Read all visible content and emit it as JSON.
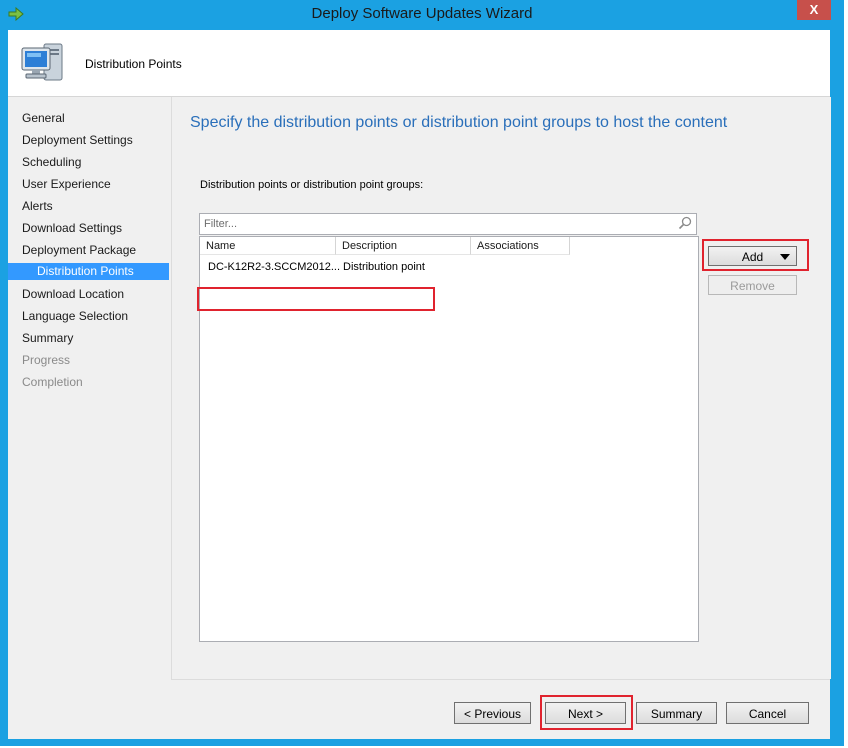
{
  "window": {
    "title": "Deploy Software Updates Wizard",
    "close_label": "X"
  },
  "header": {
    "title": "Distribution Points"
  },
  "nav": {
    "items": [
      {
        "label": "General",
        "state": "normal"
      },
      {
        "label": "Deployment Settings",
        "state": "normal"
      },
      {
        "label": "Scheduling",
        "state": "normal"
      },
      {
        "label": "User Experience",
        "state": "normal"
      },
      {
        "label": "Alerts",
        "state": "normal"
      },
      {
        "label": "Download Settings",
        "state": "normal"
      },
      {
        "label": "Deployment Package",
        "state": "normal"
      },
      {
        "label": "Distribution Points",
        "state": "selected"
      },
      {
        "label": "Download Location",
        "state": "normal"
      },
      {
        "label": "Language Selection",
        "state": "normal"
      },
      {
        "label": "Summary",
        "state": "normal"
      },
      {
        "label": "Progress",
        "state": "disabled"
      },
      {
        "label": "Completion",
        "state": "disabled"
      }
    ]
  },
  "main": {
    "heading": "Specify the distribution points or distribution point groups to host the content",
    "list_label": "Distribution points or distribution point groups:",
    "filter_placeholder": "Filter...",
    "columns": [
      "Name",
      "Description",
      "Associations"
    ],
    "rows": [
      {
        "name": "DC-K12R2-3.SCCM2012...",
        "description": "Distribution point",
        "associations": ""
      }
    ],
    "add_label": "Add",
    "remove_label": "Remove"
  },
  "footer": {
    "previous_label": "< Previous",
    "next_label": "Next >",
    "summary_label": "Summary",
    "cancel_label": "Cancel"
  },
  "colors": {
    "accent": "#1ba1e2",
    "selection": "#3399ff",
    "highlight": "#e0232e",
    "heading": "#2a6fba"
  }
}
